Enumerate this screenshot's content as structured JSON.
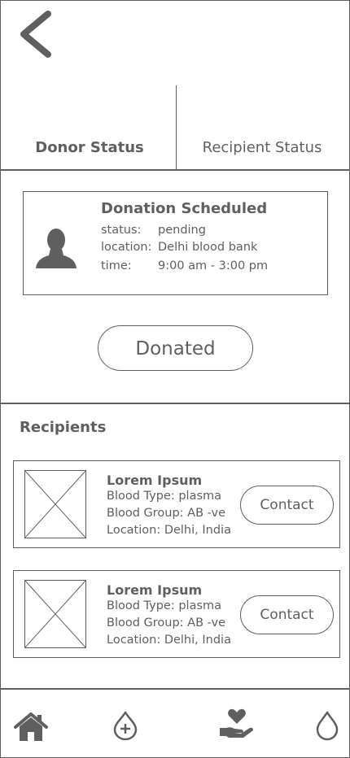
{
  "header": {
    "back_icon": "chevron-left-icon"
  },
  "tabs": [
    {
      "label": "Donor Status",
      "active": true
    },
    {
      "label": "Recipient Status",
      "active": false
    }
  ],
  "donation": {
    "title": "Donation Scheduled",
    "avatar_icon": "person-icon",
    "fields": [
      {
        "label": "status:",
        "value": "pending"
      },
      {
        "label": "location:",
        "value": "Delhi blood bank"
      },
      {
        "label": "time:",
        "value": "9:00 am - 3:00 pm"
      }
    ],
    "button_label": "Donated"
  },
  "recipients": {
    "title": "Recipients",
    "items": [
      {
        "name": "Lorem Ipsum",
        "blood_type": "Blood Type: plasma",
        "blood_group": "Blood Group: AB -ve",
        "location": "Location: Delhi, India",
        "contact_label": "Contact"
      },
      {
        "name": "Lorem Ipsum",
        "blood_type": "Blood Type: plasma",
        "blood_group": "Blood Group: AB -ve",
        "location": "Location: Delhi, India",
        "contact_label": "Contact"
      }
    ]
  },
  "bottom_nav": [
    "home-icon",
    "add-drop-icon",
    "donate-hand-heart-icon",
    "blood-drop-icon"
  ],
  "colors": {
    "ink": "#5f5f5f",
    "background": "#ffffff"
  }
}
